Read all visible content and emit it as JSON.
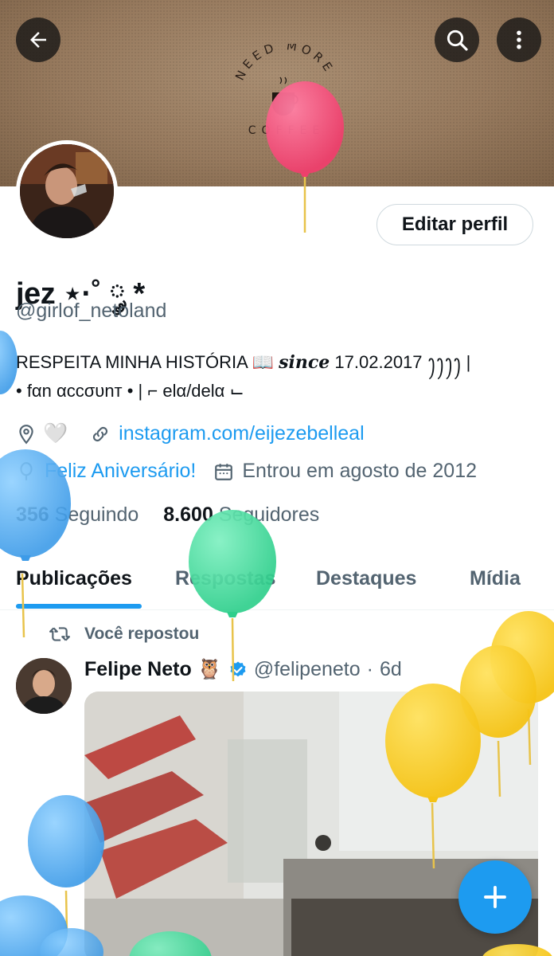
{
  "banner": {
    "logo_top_text": "NEED MORE",
    "logo_bottom_text": "COFFEE"
  },
  "icons": {
    "back": "arrow-left-icon",
    "search": "search-icon",
    "more": "more-vertical-icon",
    "location": "location-pin-icon",
    "link": "link-icon",
    "birthday": "balloon-icon",
    "calendar": "calendar-icon",
    "repost": "repost-icon",
    "verified": "verified-badge-icon",
    "compose": "plus-icon"
  },
  "colors": {
    "accent": "#1d9bf0",
    "text_primary": "#0f1419",
    "text_secondary": "#536471"
  },
  "profile": {
    "edit_button": "Editar perfil",
    "display_name": "jez ⋆·˚ ༘ *",
    "handle": "@girlof_netoland",
    "bio_line1_a": "RESPEITA MINHA HISTÓRIA 📖 ",
    "bio_line1_since": "since",
    "bio_line1_b": " 17.02.2017 ꫂꫂꫂꫂ      |",
    "bio_line2": "• fαn αccσυnт • | ⌐ elα/delα ⌙",
    "location": "🤍",
    "website": "instagram.com/eijezebelleal",
    "birthday": "Feliz Aniversário!",
    "joined": "Entrou em agosto de 2012",
    "following_count": "356",
    "following_label": "Seguindo",
    "followers_count": "8.600",
    "followers_label": "Seguidores"
  },
  "tabs": [
    {
      "label": "Publicações",
      "active": true
    },
    {
      "label": "Respostas",
      "active": false
    },
    {
      "label": "Destaques",
      "active": false
    },
    {
      "label": "Mídia",
      "active": false
    }
  ],
  "post": {
    "repost_label": "Você repostou",
    "author_name": "Felipe Neto 🦉",
    "author_handle": "@felipeneto",
    "separator": "·",
    "time": "6d"
  }
}
